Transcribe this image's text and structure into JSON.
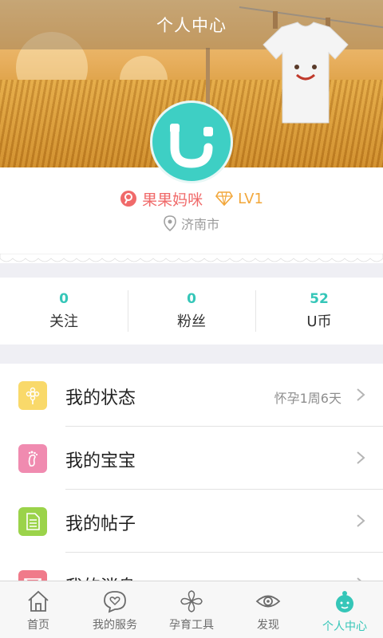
{
  "header": {
    "title": "个人中心"
  },
  "profile": {
    "nickname": "果果妈咪",
    "level": "LV1",
    "location": "济南市"
  },
  "stats": [
    {
      "value": "0",
      "label": "关注"
    },
    {
      "value": "0",
      "label": "粉丝"
    },
    {
      "value": "52",
      "label": "U币"
    }
  ],
  "menu": [
    {
      "label": "我的状态",
      "extra": "怀孕1周6天",
      "icon": "flower-icon",
      "color": "#f9d96a"
    },
    {
      "label": "我的宝宝",
      "extra": "",
      "icon": "footprint-icon",
      "color": "#f08bb0"
    },
    {
      "label": "我的帖子",
      "extra": "",
      "icon": "document-icon",
      "color": "#9bd34a"
    },
    {
      "label": "我的消息",
      "extra": "",
      "icon": "mail-icon",
      "color": "#f07a8a"
    }
  ],
  "tabs": [
    {
      "label": "首页",
      "icon": "home-icon"
    },
    {
      "label": "我的服务",
      "icon": "heart-bubble-icon"
    },
    {
      "label": "孕育工具",
      "icon": "petals-icon"
    },
    {
      "label": "发现",
      "icon": "eye-icon"
    },
    {
      "label": "个人中心",
      "icon": "baby-face-icon",
      "active": true
    }
  ],
  "colors": {
    "accent": "#35c6b8",
    "name": "#f06a6a",
    "level": "#f2a73b"
  }
}
